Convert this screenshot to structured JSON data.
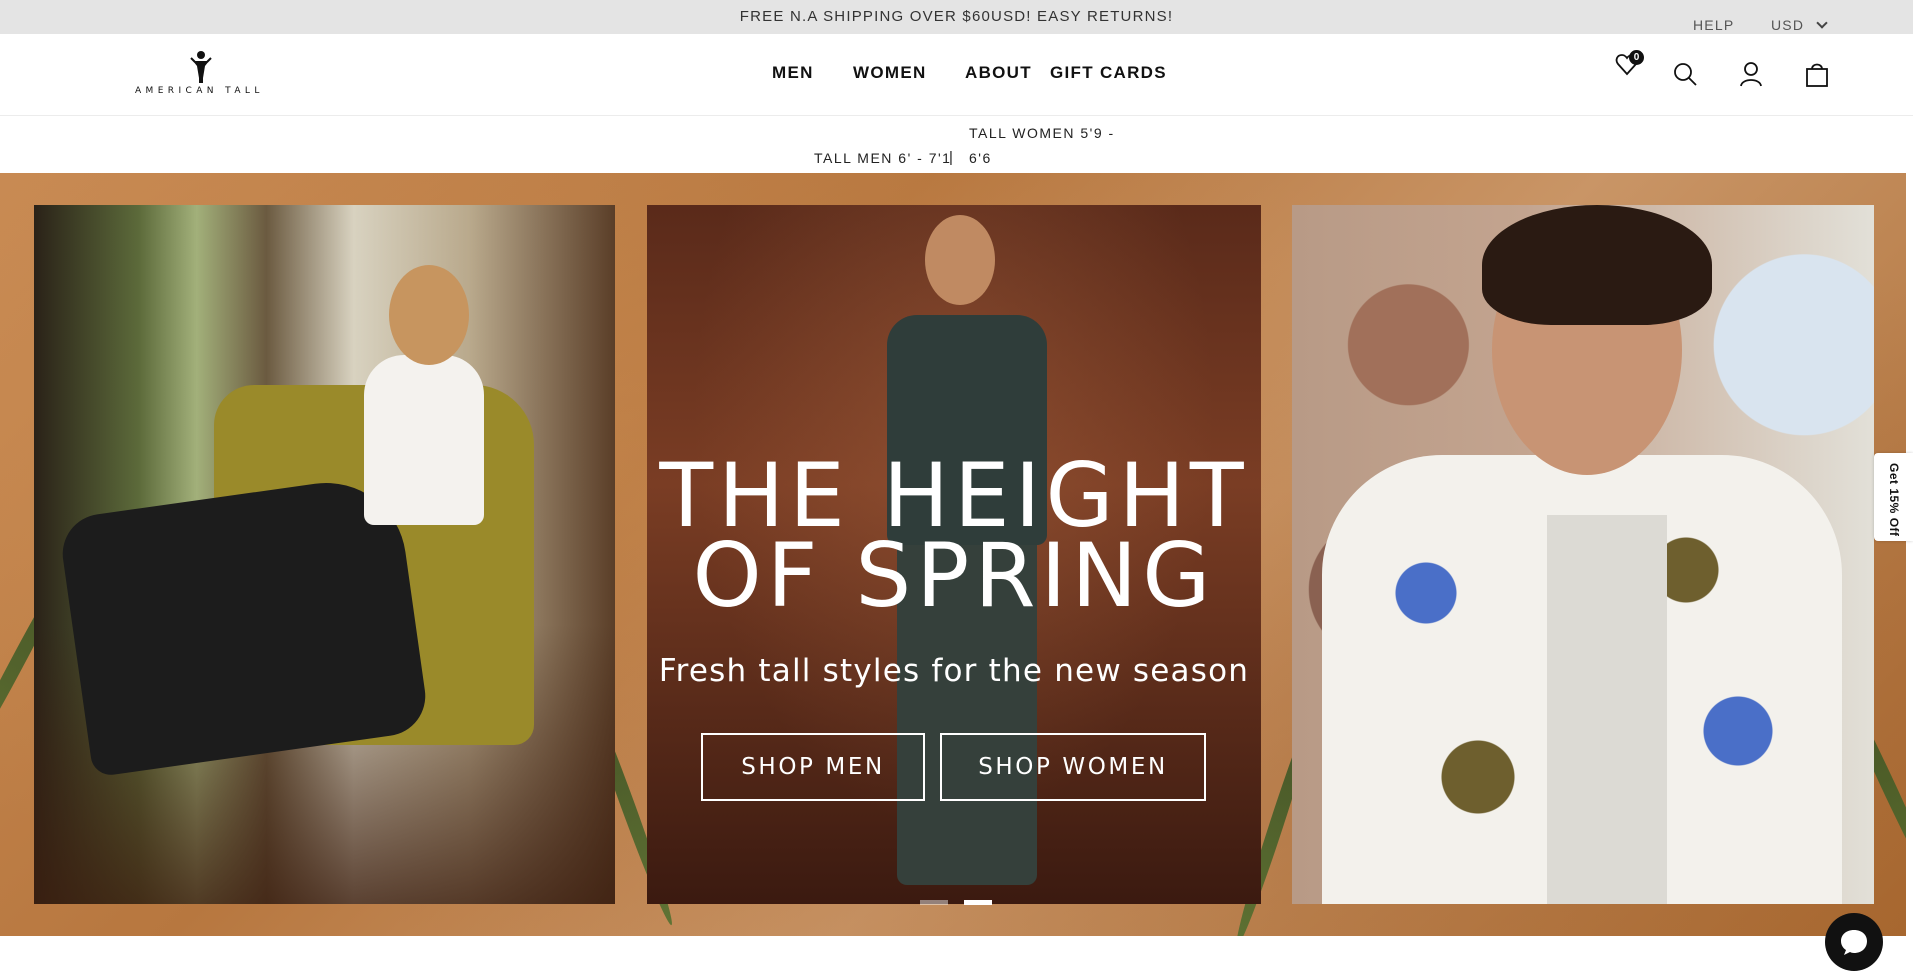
{
  "announcement": {
    "text": "FREE N.A SHIPPING OVER $60USD! EASY RETURNS!"
  },
  "utility": {
    "help": "HELP",
    "currency": "USD"
  },
  "header": {
    "logo_text": "AMERICAN TALL",
    "nav": {
      "men": "MEN",
      "women": "WOMEN",
      "about": "ABOUT",
      "gift_cards": "GIFT CARDS"
    },
    "wishlist_count": "0",
    "icons": [
      "heart-icon",
      "search-icon",
      "account-icon",
      "bag-icon"
    ]
  },
  "height_banner": {
    "women_top": "TALL WOMEN 5'9 -",
    "men": "TALL MEN 6' - 7'1",
    "separator": "|",
    "women_bottom": "6'6"
  },
  "hero": {
    "title_line1": "THE HEIGHT",
    "title_line2": "OF SPRING",
    "subtitle": "Fresh tall styles for the new season",
    "cta_men": "SHOP MEN",
    "cta_women": "SHOP WOMEN",
    "slides": 2,
    "active_slide": 2
  },
  "side_tab": {
    "label": "Get 15% Off"
  },
  "chat": {
    "icon": "chat-bubble-icon"
  },
  "colors": {
    "announcement_bg": "#e4e4e4",
    "text": "#111111",
    "hero_border": "#c08a55"
  }
}
